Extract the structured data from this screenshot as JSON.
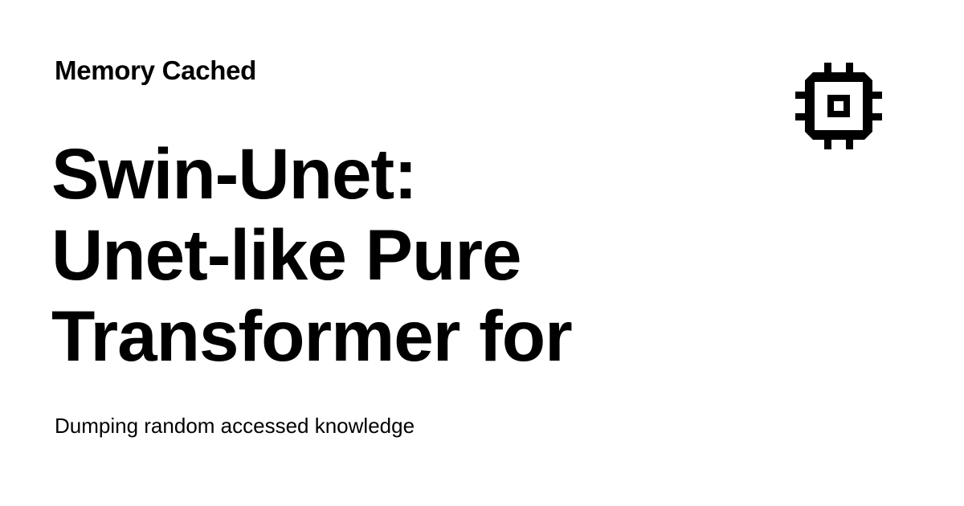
{
  "site": {
    "name": "Memory Cached",
    "tagline": "Dumping random accessed knowledge",
    "logo_icon": "cpu-chip-icon"
  },
  "post": {
    "title_lines": [
      "Swin-Unet:",
      "Unet-like Pure",
      "Transformer for"
    ]
  },
  "colors": {
    "background": "#ffffff",
    "text": "#000000"
  }
}
